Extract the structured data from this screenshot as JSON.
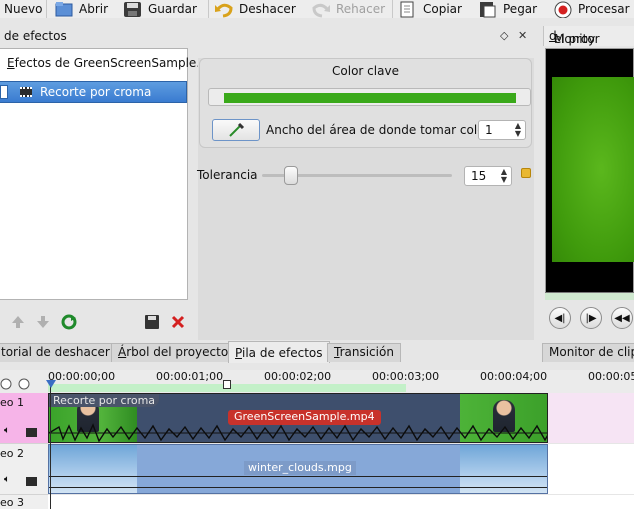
{
  "toolbar": {
    "items": [
      {
        "label": "Nuevo",
        "icon": "new-file-icon",
        "enabled": true
      },
      {
        "label": "Abrir",
        "icon": "open-icon",
        "enabled": true
      },
      {
        "label": "Guardar",
        "icon": "save-icon",
        "enabled": true
      },
      {
        "label": "Deshacer",
        "icon": "undo-icon",
        "enabled": true
      },
      {
        "label": "Rehacer",
        "icon": "redo-icon",
        "enabled": false
      },
      {
        "label": "Copiar",
        "icon": "copy-icon",
        "enabled": true
      },
      {
        "label": "Pegar",
        "icon": "paste-icon",
        "enabled": true
      },
      {
        "label": "Procesar",
        "icon": "render-icon",
        "enabled": true
      }
    ]
  },
  "effects_panel": {
    "title": "de efectos",
    "list_header": "Efectos de GreenScreenSample...",
    "list_header_prefix": "E",
    "list_header_rest": "fectos de GreenScreenSample...",
    "selected_effect": "Recorte por croma"
  },
  "color_key": {
    "title": "Color clave",
    "color": "#3aa91a",
    "width_label": "Ancho del área de donde tomar color:",
    "width_value": "1"
  },
  "tolerance": {
    "label": "Tolerancia",
    "value": "15",
    "slider_fraction": 0.15
  },
  "monitor": {
    "title_prefix": "Monitor ",
    "title_underlined": "d",
    "title_rest": "el proy"
  },
  "tabs": [
    {
      "pre": "",
      "u": "",
      "rest": "torial de deshacer",
      "active": false
    },
    {
      "pre": "",
      "u": "Á",
      "rest": "rbol del proyecto",
      "active": false
    },
    {
      "pre": "",
      "u": "P",
      "rest": "ila de efectos",
      "active": true
    },
    {
      "pre": "",
      "u": "T",
      "rest": "ransición",
      "active": false
    },
    {
      "pre": "Monitor de clip",
      "u": "",
      "rest": "",
      "active": false
    }
  ],
  "timeline": {
    "timecodes": [
      "00:00:00;00",
      "00:00:01;00",
      "00:00:02;00",
      "00:00:03;00",
      "00:00:04;00",
      "00:00:05"
    ],
    "tracks": [
      {
        "label": "eo 1"
      },
      {
        "label": "eo 2"
      },
      {
        "label": "eo 3"
      }
    ],
    "clip1": {
      "effect": "Recorte por croma",
      "name": "GreenScreenSample.mp4"
    },
    "clip2": {
      "name": "winter_clouds.mpg"
    }
  },
  "colors": {
    "accent_selection": "#3a7bd0",
    "track1_head": "#f6b4e8",
    "clip_tag": "#c8322b"
  }
}
